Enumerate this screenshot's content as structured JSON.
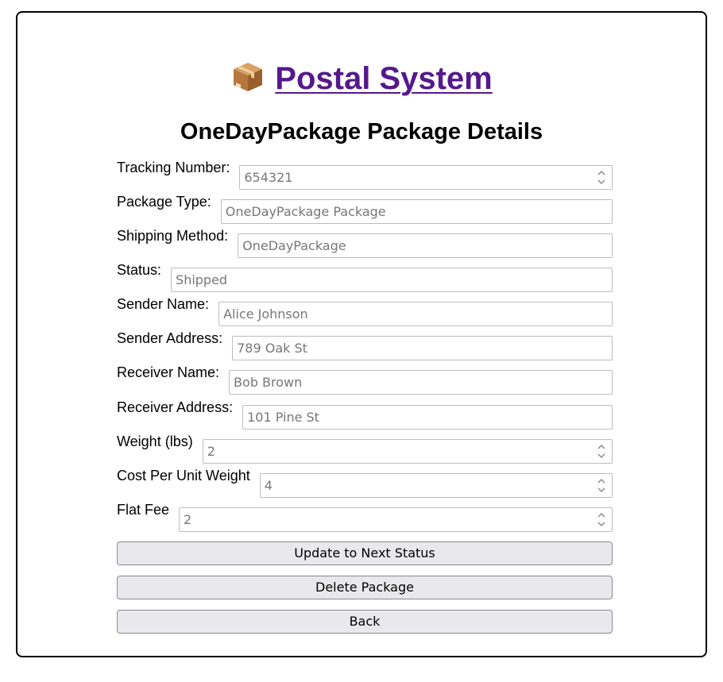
{
  "header": {
    "app_title": "Postal System",
    "page_title": "OneDayPackage Package Details"
  },
  "fields": [
    {
      "label": "Tracking Number:",
      "value": "654321",
      "type": "number"
    },
    {
      "label": "Package Type:",
      "value": "OneDayPackage Package",
      "type": "text"
    },
    {
      "label": "Shipping Method:",
      "value": "OneDayPackage",
      "type": "text"
    },
    {
      "label": "Status:",
      "value": "Shipped",
      "type": "text"
    },
    {
      "label": "Sender Name:",
      "value": "Alice Johnson",
      "type": "text"
    },
    {
      "label": "Sender Address:",
      "value": "789 Oak St",
      "type": "text"
    },
    {
      "label": "Receiver Name:",
      "value": "Bob Brown",
      "type": "text"
    },
    {
      "label": "Receiver Address:",
      "value": "101 Pine St",
      "type": "text"
    },
    {
      "label": "Weight (lbs)",
      "value": "2",
      "type": "number"
    },
    {
      "label": "Cost Per Unit Weight",
      "value": "4",
      "type": "number"
    },
    {
      "label": "Flat Fee",
      "value": "2",
      "type": "number"
    }
  ],
  "buttons": {
    "update_label": "Update to Next Status",
    "delete_label": "Delete Package",
    "back_label": "Back"
  },
  "colors": {
    "link": "#55198b",
    "button_bg": "#e9e9ed",
    "input_text": "#777777"
  },
  "icons": {
    "title_icon": "package-box-icon",
    "spinner": "number-spinner-icon"
  }
}
